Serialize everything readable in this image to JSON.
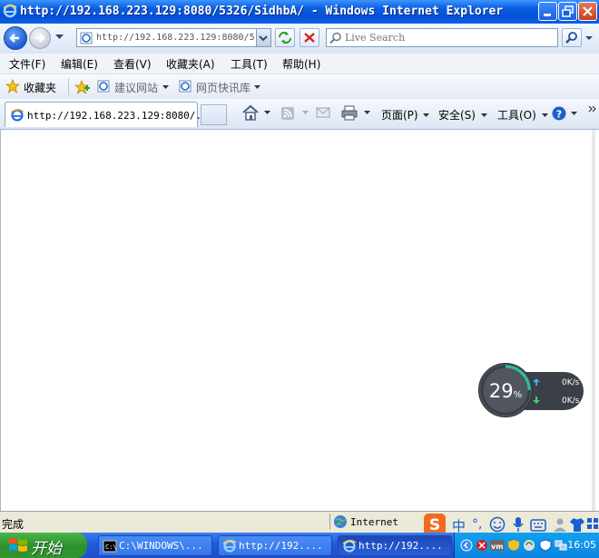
{
  "window": {
    "title": "http://192.168.223.129:8080/5326/SidhbA/ - Windows Internet Explorer"
  },
  "address_bar": {
    "url": "http://192.168.223.129:8080/5"
  },
  "search": {
    "placeholder": "Live Search"
  },
  "menu": {
    "items": [
      "文件(F)",
      "编辑(E)",
      "查看(V)",
      "收藏夹(A)",
      "工具(T)",
      "帮助(H)"
    ]
  },
  "favorites_bar": {
    "favorites_label": "收藏夹",
    "suggested_sites": "建议网站",
    "web_slice_gallery": "网页快讯库"
  },
  "tab": {
    "title": "http://192.168.223.129:8080/..."
  },
  "command_bar": {
    "page": "页面(P)",
    "safety": "安全(S)",
    "tools": "工具(O)"
  },
  "speed_widget": {
    "percent": "29",
    "percent_unit": "%",
    "upload": "0K/s",
    "download": "0K/s"
  },
  "status_bar": {
    "status": "完成",
    "zone": "Internet"
  },
  "taskbar": {
    "start_label": "开始",
    "tasks": [
      "C:\\WINDOWS\\...",
      "http://192....",
      "http://192...."
    ],
    "clock": "16:05"
  },
  "ime": {
    "mode": "中"
  },
  "colors": {
    "titlebar": "#0a5fe3",
    "taskbar": "#235ad8",
    "start_green": "#2d8f2d"
  }
}
